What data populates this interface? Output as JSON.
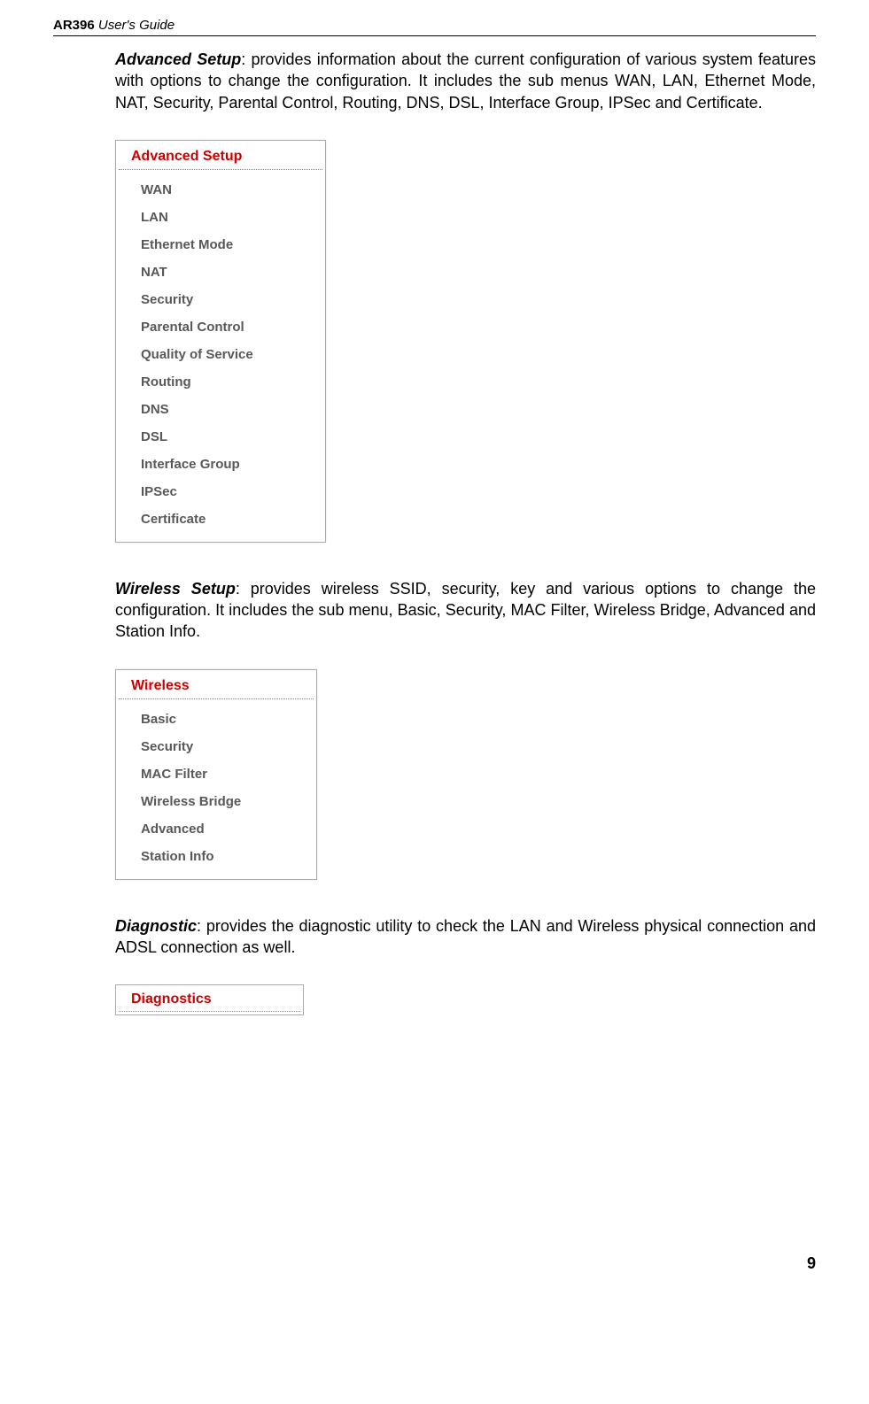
{
  "header": {
    "model": "AR396",
    "suffix": " User's Guide"
  },
  "sections": {
    "advanced": {
      "title": "Advanced Setup",
      "desc": ": provides information about the current configuration of various system features with options to change the configuration. It includes the sub menus WAN, LAN, Ethernet Mode, NAT, Security, Parental Control, Routing, DNS, DSL, Interface Group, IPSec and Certificate.",
      "menu_header": "Advanced Setup",
      "items": [
        "WAN",
        "LAN",
        "Ethernet Mode",
        "NAT",
        "Security",
        "Parental Control",
        "Quality of Service",
        "Routing",
        "DNS",
        "DSL",
        "Interface Group",
        "IPSec",
        "Certificate"
      ]
    },
    "wireless": {
      "title": "Wireless Setup",
      "desc": ": provides wireless SSID, security, key and various options to change the configuration. It includes the sub menu, Basic, Security, MAC Filter, Wireless Bridge, Advanced and Station Info.",
      "menu_header": "Wireless",
      "items": [
        "Basic",
        "Security",
        "MAC Filter",
        "Wireless Bridge",
        "Advanced",
        "Station Info"
      ]
    },
    "diagnostic": {
      "title": "Diagnostic",
      "desc": ": provides the diagnostic utility to check the LAN and Wireless physical connection and ADSL connection as well.",
      "menu_header": "Diagnostics"
    }
  },
  "page_number": "9"
}
